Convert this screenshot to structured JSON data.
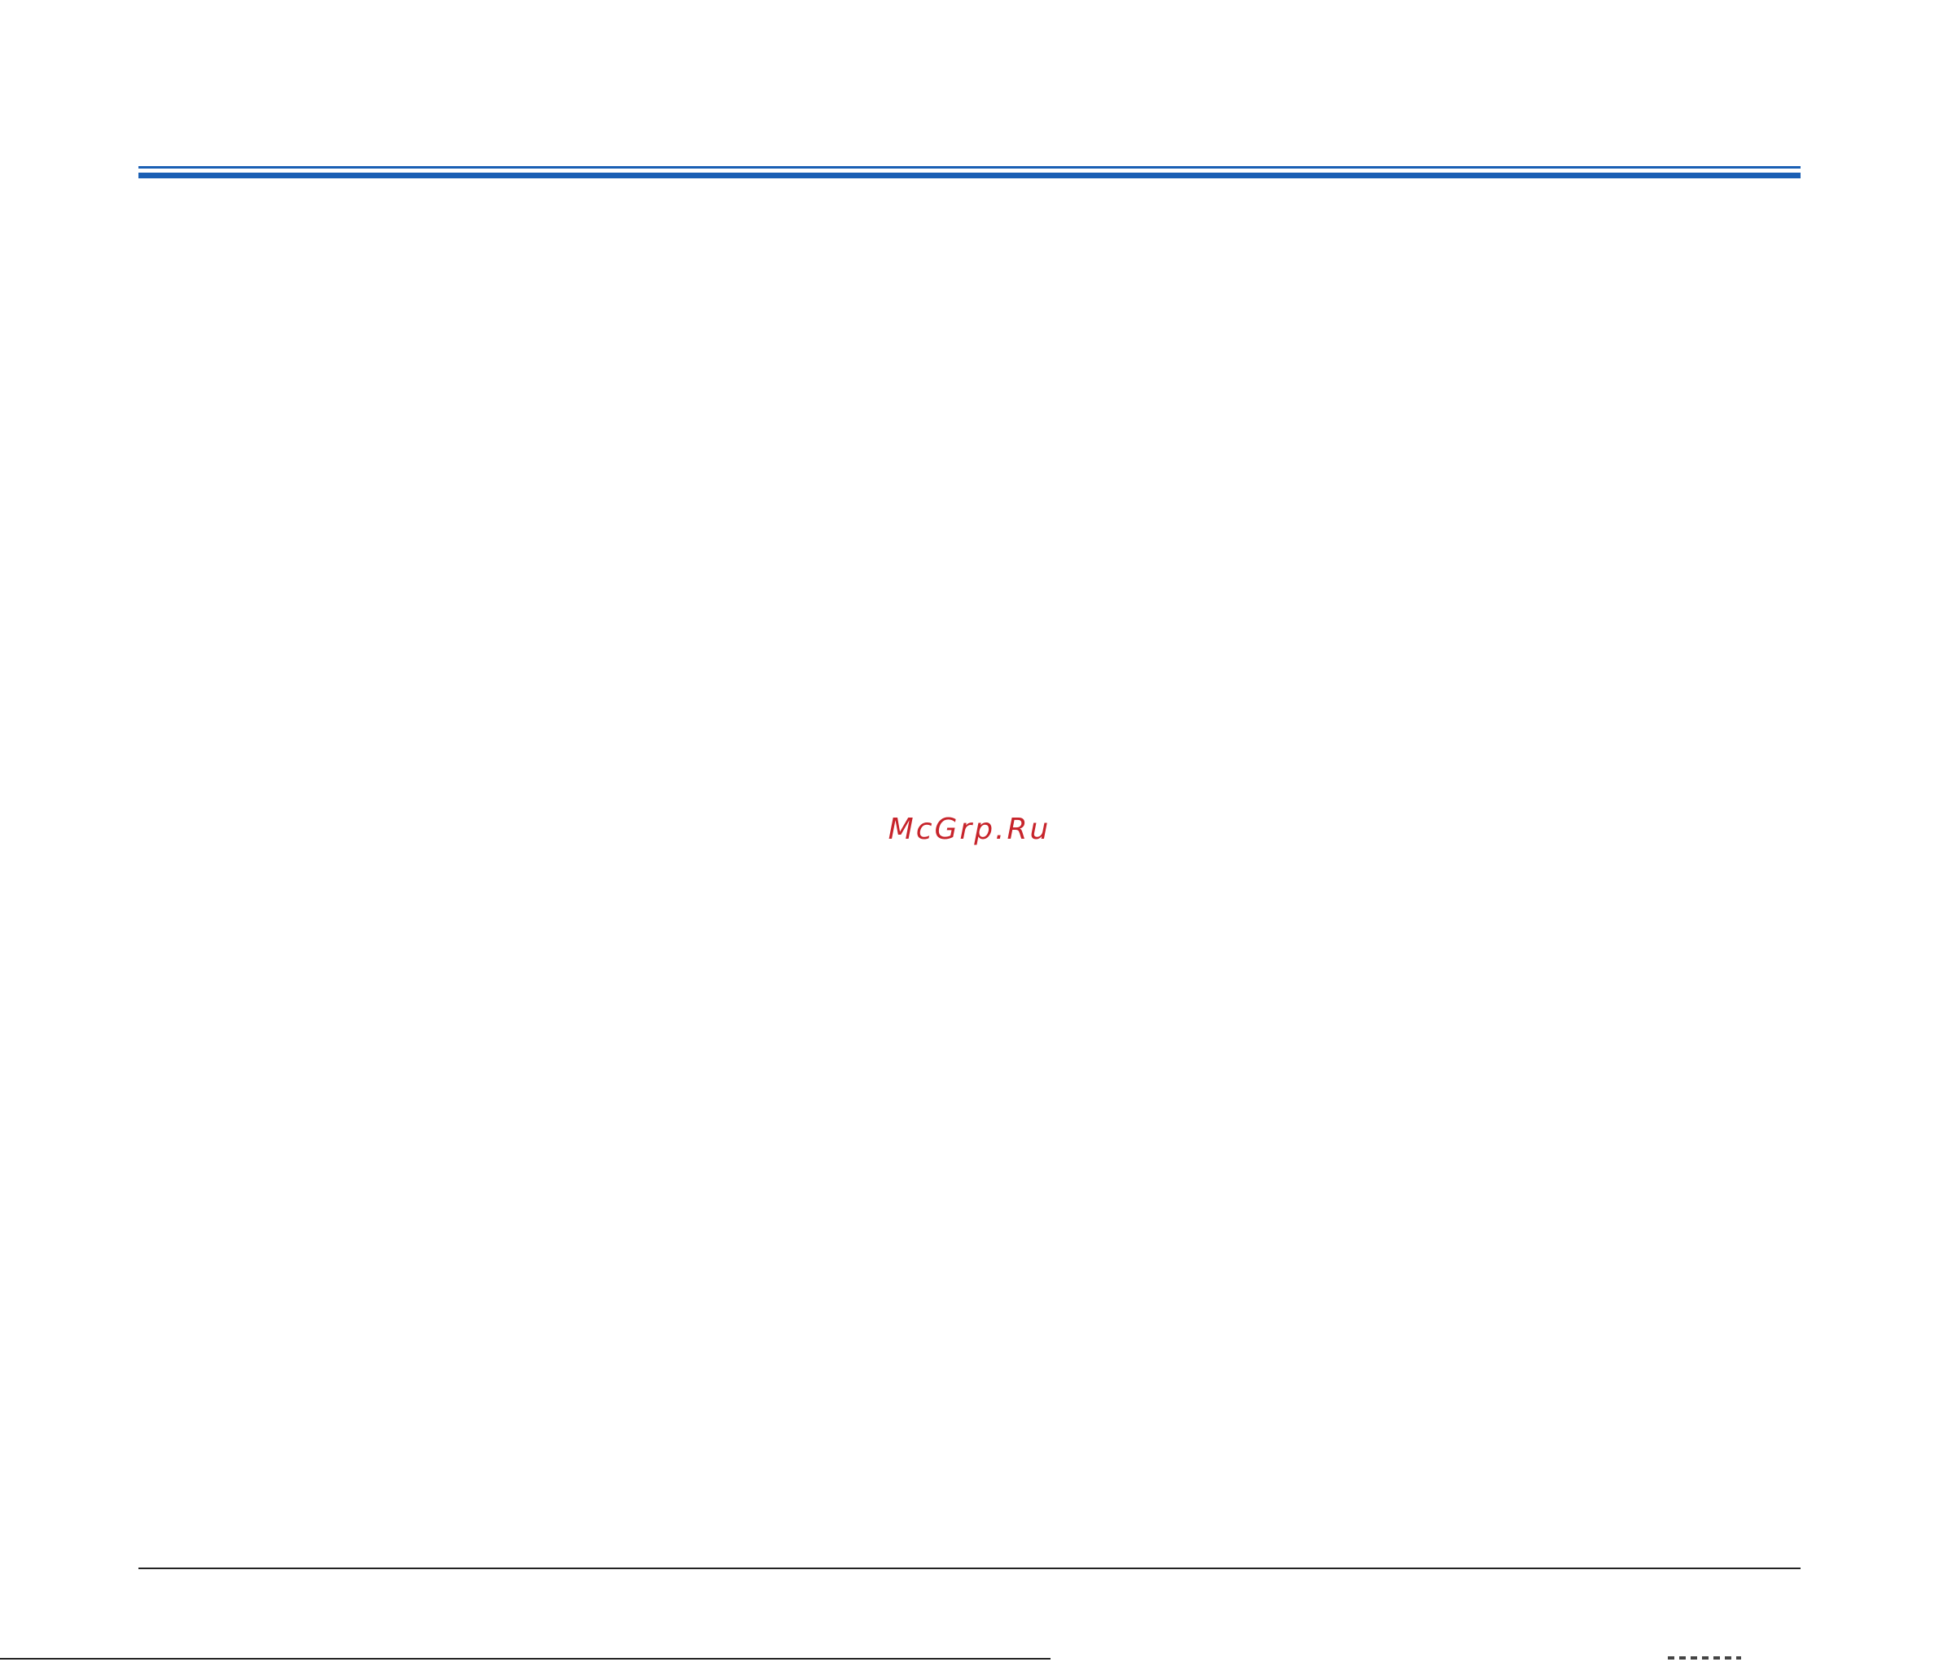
{
  "header": {
    "accent_color": "#1a5fb4"
  },
  "watermark": {
    "text": "McGrp.Ru",
    "color": "#c7242b"
  },
  "footer": {
    "rule_color": "#222222"
  }
}
